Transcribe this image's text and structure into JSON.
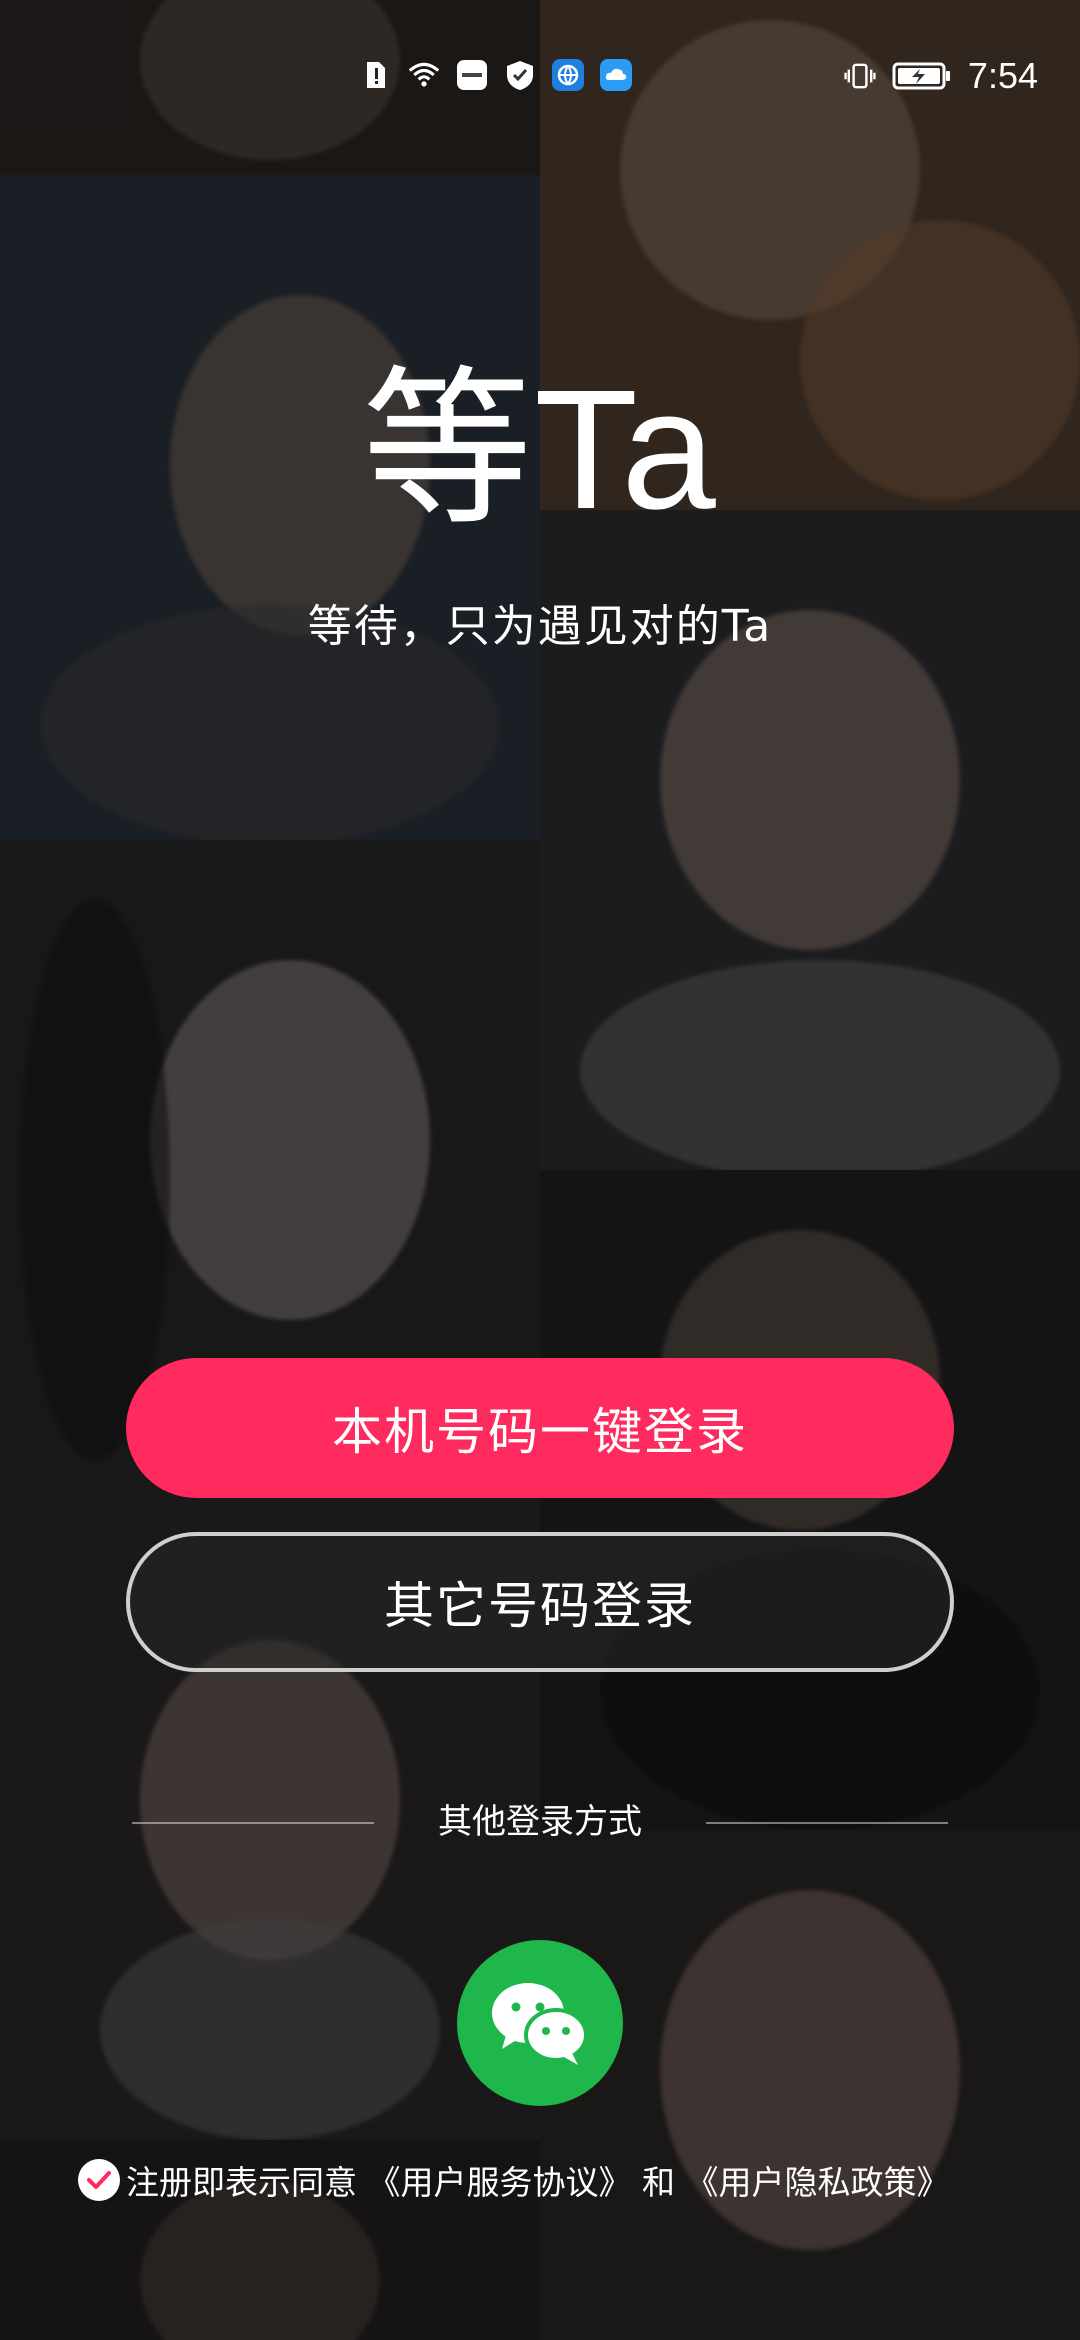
{
  "status_bar": {
    "time": "7:54",
    "icons_left": [
      "sim-alert-icon",
      "wifi-icon",
      "huawei-app-icon",
      "shield-icon",
      "browser-icon",
      "cloud-icon"
    ],
    "icons_right": [
      "vibrate-icon",
      "battery-charging-icon"
    ]
  },
  "brand": {
    "logo_text": "等Ta",
    "slogan": "等待，只为遇见对的Ta"
  },
  "buttons": {
    "one_click_login": "本机号码一键登录",
    "other_number_login": "其它号码登录"
  },
  "other_login": {
    "divider_label": "其他登录方式",
    "wechat_icon": "wechat-icon"
  },
  "agreement": {
    "prefix": "注册即表示同意",
    "user_agreement": "《用户服务协议》",
    "and": " 和 ",
    "privacy_policy": "《用户隐私政策》",
    "checked": true
  },
  "colors": {
    "primary_button": "#ff2a5e",
    "wechat_green": "#1fb64b",
    "check_mark": "#ff2a5e"
  }
}
